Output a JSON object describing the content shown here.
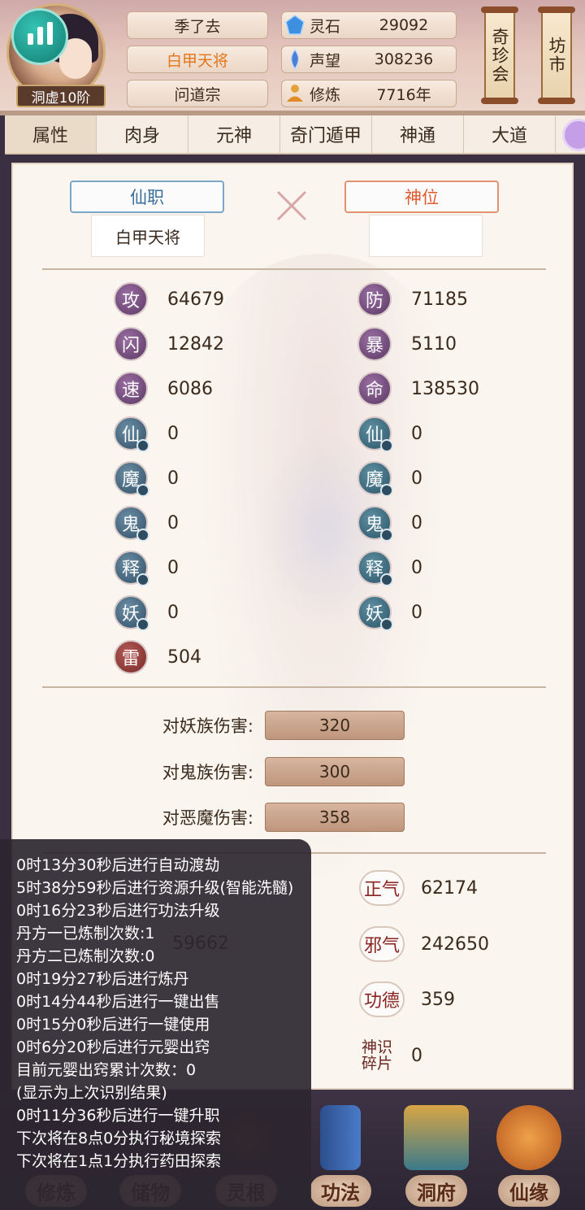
{
  "header": {
    "rank": "洞虚10阶",
    "name": "季了去",
    "title": "白甲天将",
    "sect": "问道宗",
    "resources": [
      {
        "icon": "spirit-stone-icon",
        "label": "灵石",
        "value": "29092"
      },
      {
        "icon": "reputation-icon",
        "label": "声望",
        "value": "308236"
      },
      {
        "icon": "cultivation-icon",
        "label": "修炼",
        "value": "7716年"
      }
    ],
    "scroll_buttons": [
      "奇珍会",
      "坊市"
    ]
  },
  "tabs": [
    "属性",
    "肉身",
    "元神",
    "奇门遁甲",
    "神通",
    "大道"
  ],
  "active_tab": 0,
  "titles": {
    "xianzhi_label": "仙职",
    "xianzhi_value": "白甲天将",
    "shenwei_label": "神位",
    "shenwei_value": ""
  },
  "stats_left": [
    {
      "char": "攻",
      "value": "64679",
      "color": "purple"
    },
    {
      "char": "闪",
      "value": "12842",
      "color": "purple"
    },
    {
      "char": "速",
      "value": "6086",
      "color": "purple"
    },
    {
      "char": "仙",
      "value": "0",
      "color": "blue"
    },
    {
      "char": "魔",
      "value": "0",
      "color": "blue"
    },
    {
      "char": "鬼",
      "value": "0",
      "color": "blue"
    },
    {
      "char": "释",
      "value": "0",
      "color": "blue"
    },
    {
      "char": "妖",
      "value": "0",
      "color": "blue"
    },
    {
      "char": "雷",
      "value": "504",
      "color": "red"
    }
  ],
  "stats_right": [
    {
      "char": "防",
      "value": "71185",
      "color": "purple"
    },
    {
      "char": "暴",
      "value": "5110",
      "color": "purple"
    },
    {
      "char": "命",
      "value": "138530",
      "color": "purple"
    },
    {
      "char": "仙",
      "value": "0",
      "color": "teal"
    },
    {
      "char": "魔",
      "value": "0",
      "color": "teal"
    },
    {
      "char": "鬼",
      "value": "0",
      "color": "teal"
    },
    {
      "char": "释",
      "value": "0",
      "color": "teal"
    },
    {
      "char": "妖",
      "value": "0",
      "color": "teal"
    }
  ],
  "damage_bonus": [
    {
      "label": "对妖族伤害:",
      "value": "320"
    },
    {
      "label": "对鬼族伤害:",
      "value": "300"
    },
    {
      "label": "对恶魔伤害:",
      "value": "358"
    }
  ],
  "right_attrs": [
    {
      "label": "正气",
      "value": "62174"
    },
    {
      "label": "邪气",
      "value": "242650"
    },
    {
      "label": "功德",
      "value": "359"
    },
    {
      "label": "神识碎片",
      "value": "0"
    }
  ],
  "partially_hidden_value": "59662",
  "log_lines": [
    "0时13分30秒后进行自动渡劫",
    "5时38分59秒后进行资源升级(智能洗髓)",
    "0时16分23秒后进行功法升级",
    "丹方一已炼制次数:1",
    "丹方二已炼制次数:0",
    "0时19分27秒后进行炼丹",
    "0时14分44秒后进行一键出售",
    "0时15分0秒后进行一键使用",
    "0时6分20秒后进行元婴出窍",
    "目前元婴出窍累计次数：0",
    "(显示为上次识别结果)",
    "0时11分36秒后进行一键升职",
    "下次将在8点0分执行秘境探索",
    "下次将在1点1分执行药田探索"
  ],
  "bottom_nav": [
    "修炼",
    "储物",
    "灵根",
    "功法",
    "洞府",
    "仙缘"
  ]
}
